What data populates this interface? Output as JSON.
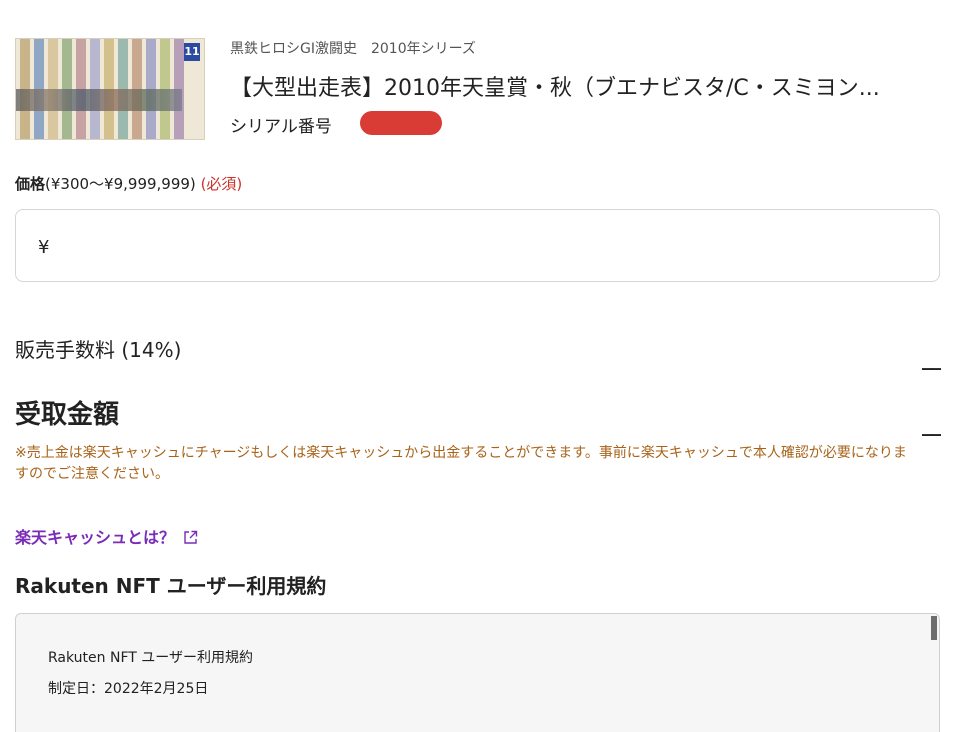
{
  "product": {
    "thumbnail_icon": "race-entry-sheet-thumbnail",
    "badge": "11",
    "series": "黒鉄ヒロシGⅠ激闘史　2010年シリーズ",
    "title": "【大型出走表】2010年天皇賞・秋（ブエナビスタ/C・スミヨン...",
    "serial_label": "シリアル番号"
  },
  "price": {
    "label_bold": "価格",
    "label_range": "(¥300〜¥9,999,999)",
    "label_required": "(必須)",
    "currency": "¥",
    "value": ""
  },
  "fee": {
    "label": "販売手数料 (14%)",
    "value": "__"
  },
  "receive": {
    "label": "受取金額",
    "value": "__"
  },
  "note": "※売上金は楽天キャッシュにチャージもしくは楽天キャッシュから出金することができます。事前に楽天キャッシュで本人確認が必要になりますのでご注意ください。",
  "cash_link": {
    "label": "楽天キャッシュとは？",
    "icon": "external-link-icon"
  },
  "terms": {
    "heading": "Rakuten NFT ユーザー利用規約",
    "line1": "Rakuten NFT ユーザー利用規約",
    "line2": "制定日：2022年2月25日"
  },
  "colors": {
    "required": "#c8332b",
    "note": "#a8631a",
    "link": "#7b2bb8",
    "serial_mask": "#d93b35"
  }
}
